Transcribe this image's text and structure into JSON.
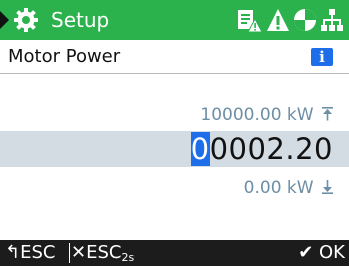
{
  "header": {
    "title": "Setup",
    "background_color": "#2bb24c",
    "icons": [
      "gear-icon",
      "parameter-write-icon",
      "warning-icon",
      "pie-status-icon",
      "network-icon"
    ]
  },
  "parameter": {
    "name": "Motor Power",
    "info_label": "i"
  },
  "limits": {
    "max": "10000.00 kW",
    "min": "0.00 kW",
    "max_icon": "upper-limit-icon",
    "min_icon": "lower-limit-icon"
  },
  "edit": {
    "cursor_digit": "0",
    "remaining_digits": "0002.20",
    "highlight_color": "#1d6ee8"
  },
  "footer": {
    "back_label": "ESC",
    "back_icon": "back-arrow-icon",
    "cancel_label": "ESC",
    "cancel_subscript": "2s",
    "cancel_icon": "close-icon",
    "ok_label": "OK",
    "ok_icon": "check-icon"
  }
}
